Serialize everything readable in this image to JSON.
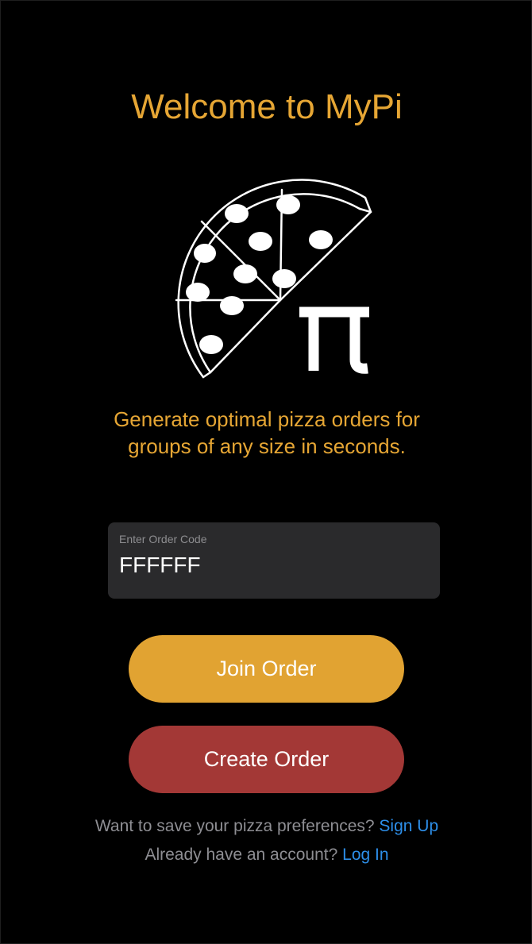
{
  "title": "Welcome to MyPi",
  "logo": {
    "icon": "pizza-slice-pi-icon"
  },
  "tagline": {
    "line1": "Generate optimal pizza orders for",
    "line2": "groups of any size in seconds."
  },
  "order_input": {
    "label": "Enter Order Code",
    "value": "FFFFFF"
  },
  "buttons": {
    "join_label": "Join Order",
    "create_label": "Create Order"
  },
  "footer": {
    "signup_prompt": "Want to save your pizza preferences?",
    "signup_link": "Sign Up",
    "login_prompt": "Already have an account?",
    "login_link": "Log In"
  },
  "colors": {
    "accent": "#E6A634",
    "join_button": "#E1A332",
    "create_button": "#A33836",
    "link": "#2D8EE8",
    "background": "#000000",
    "input_background": "#2A2A2C"
  }
}
